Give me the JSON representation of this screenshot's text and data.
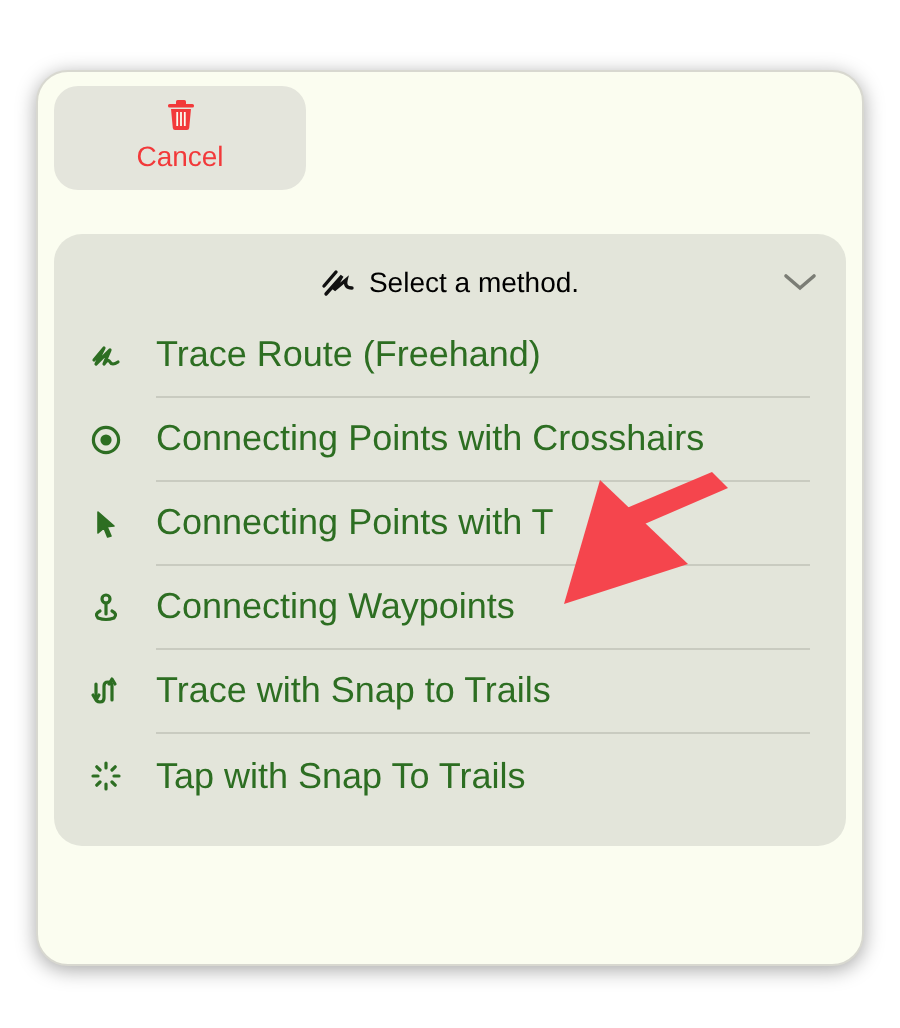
{
  "cancel_button": {
    "label": "Cancel"
  },
  "method_panel": {
    "title": "Select a method.",
    "expanded": true,
    "items": [
      {
        "kind": "freehand",
        "label": "Trace Route (Freehand)"
      },
      {
        "kind": "crosshairs",
        "label": "Connecting Points with Crosshairs"
      },
      {
        "kind": "pointer",
        "label": "Connecting Points with T"
      },
      {
        "kind": "waypoint",
        "label": "Connecting Waypoints"
      },
      {
        "kind": "snap-trace",
        "label": "Trace with Snap to Trails"
      },
      {
        "kind": "snap-tap",
        "label": "Tap with Snap To Trails"
      }
    ]
  }
}
